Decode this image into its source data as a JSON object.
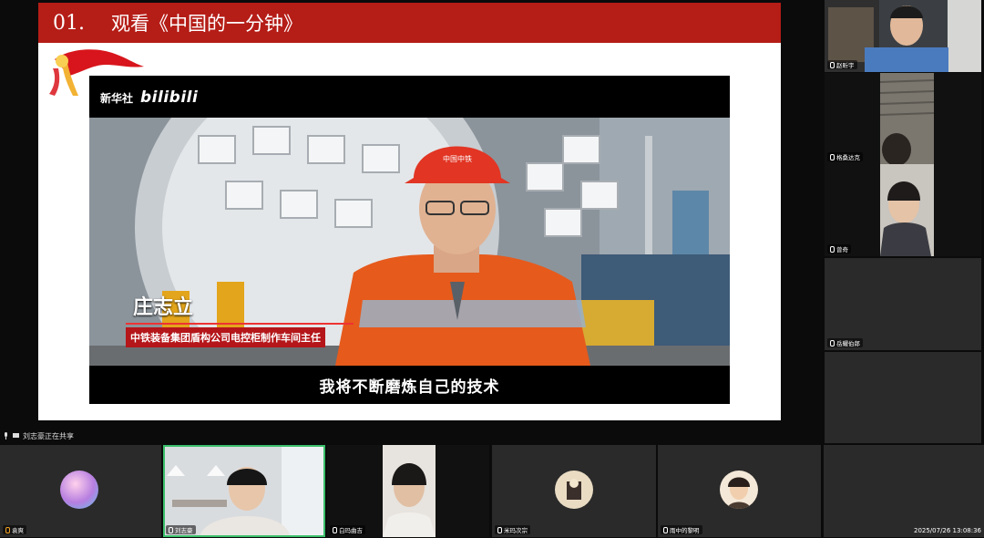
{
  "slide": {
    "number": "01.",
    "title": "观看《中国的一分钟》"
  },
  "video": {
    "logo_xinhua": "新华社",
    "logo_bili": "bilibili",
    "helmet_text": "中国中铁",
    "name": "庄志立",
    "role": "中铁装备集团盾构公司电控柜制作车间主任",
    "subtitle": "我将不断磨炼自己的技术"
  },
  "share_status": "刘志豪正在共享",
  "participants_right": [
    {
      "label": "赵昕宇"
    },
    {
      "label": "格桑达克"
    },
    {
      "label": "曾奇"
    },
    {
      "label": "岳耀伯郎"
    }
  ],
  "participants_bottom": [
    {
      "label": "袁爽"
    },
    {
      "label": "刘志豪"
    },
    {
      "label": "白玛曲吉"
    },
    {
      "label": "米玛次宗"
    },
    {
      "label": "雨中的黎明"
    }
  ],
  "timestamp": "2025/07/26 13:08:36",
  "colors": {
    "header_red": "#b51d17",
    "active_speaker": "#3bbf6b"
  }
}
